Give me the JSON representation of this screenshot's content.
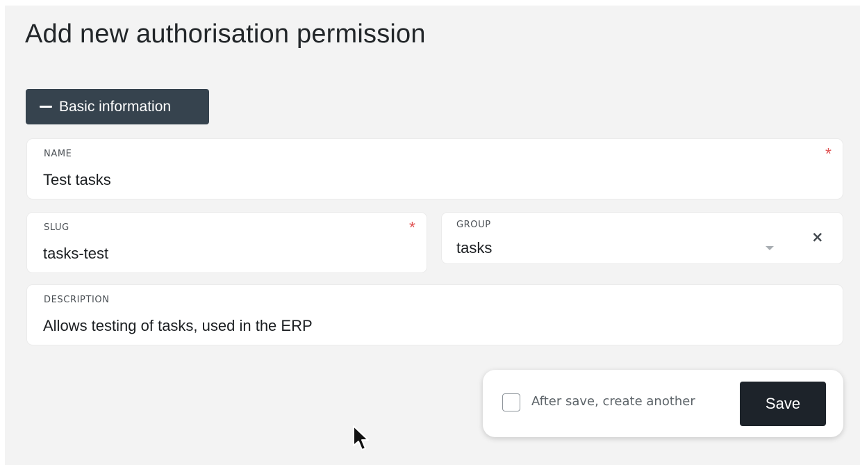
{
  "page": {
    "title": "Add new authorisation permission"
  },
  "section": {
    "label": "Basic information"
  },
  "fields": {
    "name": {
      "label": "NAME",
      "value": "Test tasks",
      "required": "*"
    },
    "slug": {
      "label": "SLUG",
      "value": "tasks-test",
      "required": "*"
    },
    "group": {
      "label": "GROUP",
      "value": "tasks",
      "clear": "×"
    },
    "description": {
      "label": "DESCRIPTION",
      "value": "Allows testing of tasks, used in the ERP"
    }
  },
  "footer": {
    "checkbox_label": "After save, create another",
    "checkbox_checked": false,
    "save_label": "Save"
  },
  "icons": [
    "minus-icon",
    "chevron-down-icon",
    "close-icon",
    "mouse-pointer-icon"
  ],
  "colors": {
    "background": "#f3f3f3",
    "section_button": "#36434e",
    "save_button": "#1d232a",
    "required": "#e05252"
  }
}
